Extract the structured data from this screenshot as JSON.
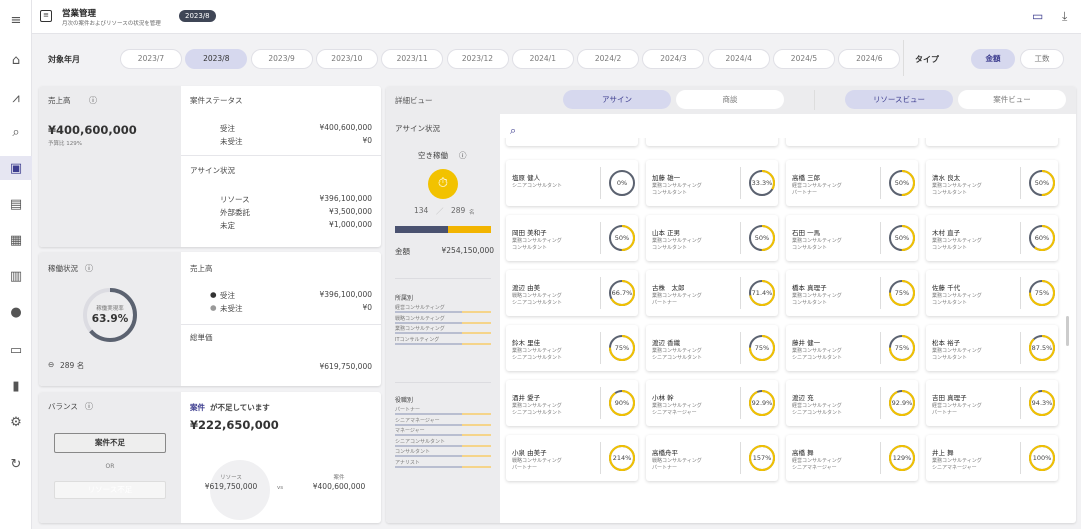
{
  "app": {
    "title": "営業管理",
    "subtitle": "月次の案件およびリソースの状況を管理",
    "month_badge": "2023/8"
  },
  "sidebar": {
    "icons": [
      "menu-icon",
      "home-icon",
      "chart-icon",
      "search-doc-icon",
      "clipboard-icon",
      "list-icon",
      "calendar-icon",
      "building-icon",
      "person-icon",
      "card-icon",
      "bar-chart-icon",
      "gear-icon",
      "refresh-icon"
    ]
  },
  "filter": {
    "month_label": "対象年月",
    "months": [
      "2023/7",
      "2023/8",
      "2023/9",
      "2023/10",
      "2023/11",
      "2023/12",
      "2024/1",
      "2024/2",
      "2024/3",
      "2024/4",
      "2024/5",
      "2024/6"
    ],
    "selected_month": "2023/8",
    "type_label": "タイプ",
    "types": [
      "金額",
      "工数"
    ],
    "selected_type": "金額"
  },
  "sales_card": {
    "title": "売上高",
    "total": "¥400,600,000",
    "budget_ratio": "予算比 129%",
    "status_title": "案件ステータス",
    "status_rows": [
      {
        "label": "受注",
        "value": "¥400,600,000"
      },
      {
        "label": "未受注",
        "value": "¥0"
      }
    ],
    "assign_title": "アサイン状況",
    "assign_rows": [
      {
        "label": "リソース",
        "value": "¥396,100,000"
      },
      {
        "label": "外部委託",
        "value": "¥3,500,000"
      },
      {
        "label": "未定",
        "value": "¥1,000,000"
      }
    ]
  },
  "utilization_card": {
    "title": "稼働状況",
    "gauge_label": "稼働実現率",
    "gauge_value": "63.9%",
    "gauge_fraction": 0.639,
    "people": "289 名",
    "sales_title": "売上高",
    "sales_rows": [
      {
        "label": "受注",
        "value": "¥396,100,000"
      },
      {
        "label": "未受注",
        "value": "¥0"
      }
    ],
    "total_title": "総単価",
    "total_value": "¥619,750,000"
  },
  "balance_card": {
    "title": "バランス",
    "btn_shortage": "案件不足",
    "or": "OR",
    "btn_resource": "リソース不足",
    "message_em": "案件",
    "message": "が不足しています",
    "diff": "¥222,650,000",
    "resource_label": "リソース",
    "resource_value": "¥619,750,000",
    "vs": "vs",
    "project_label": "案件",
    "project_value": "¥400,600,000"
  },
  "detail": {
    "title": "詳細ビュー",
    "tabs_left": [
      "アサイン",
      "商談"
    ],
    "tabs_right": [
      "リソースビュー",
      "案件ビュー"
    ],
    "assign_title": "アサイン状況",
    "idle_label": "空き稼働",
    "idle_count": "134",
    "slash": "／",
    "total_count": "289",
    "unit": "名",
    "amount_label": "金額",
    "amount_value": "¥254,150,000",
    "dept_title": "所属別",
    "depts": [
      "経営コンサルティング",
      "戦略コンサルティング",
      "業務コンサルティング",
      "ITコンサルティング"
    ],
    "role_title": "役職別",
    "roles": [
      "パートナー",
      "シニアマネージャー",
      "マネージャー",
      "シニアコンサルタント",
      "コンサルタント",
      "アナリスト"
    ]
  },
  "people": [
    {
      "name": "塩原 健人",
      "dept": "シニアコンサルタント",
      "role": "",
      "pct": "0%",
      "frac": 0
    },
    {
      "name": "加藤 雄一",
      "dept": "業務コンサルティング",
      "role": "コンサルタント",
      "pct": "33.3%",
      "frac": 0.333
    },
    {
      "name": "高橋 三郎",
      "dept": "経営コンサルティング",
      "role": "パートナー",
      "pct": "50%",
      "frac": 0.5
    },
    {
      "name": "清水 良太",
      "dept": "業務コンサルティング",
      "role": "コンサルタント",
      "pct": "50%",
      "frac": 0.5
    },
    {
      "name": "岡田 美和子",
      "dept": "業務コンサルティング",
      "role": "コンサルタント",
      "pct": "50%",
      "frac": 0.5
    },
    {
      "name": "山本 正男",
      "dept": "業務コンサルティング",
      "role": "コンサルタント",
      "pct": "50%",
      "frac": 0.5
    },
    {
      "name": "石田 一馬",
      "dept": "業務コンサルティング",
      "role": "コンサルタント",
      "pct": "50%",
      "frac": 0.5
    },
    {
      "name": "木村 直子",
      "dept": "業務コンサルティング",
      "role": "コンサルタント",
      "pct": "60%",
      "frac": 0.6
    },
    {
      "name": "渡辺 由美",
      "dept": "戦略コンサルティング",
      "role": "シニアコンサルタント",
      "pct": "66.7%",
      "frac": 0.667
    },
    {
      "name": "古株　太郎",
      "dept": "業務コンサルティング",
      "role": "パートナー",
      "pct": "71.4%",
      "frac": 0.714
    },
    {
      "name": "橋本 真理子",
      "dept": "業務コンサルティング",
      "role": "コンサルタント",
      "pct": "75%",
      "frac": 0.75
    },
    {
      "name": "佐藤 千代",
      "dept": "業務コンサルティング",
      "role": "コンサルタント",
      "pct": "75%",
      "frac": 0.75
    },
    {
      "name": "鈴木 里佳",
      "dept": "業務コンサルティング",
      "role": "シニアコンサルタント",
      "pct": "75%",
      "frac": 0.75
    },
    {
      "name": "渡辺 香織",
      "dept": "業務コンサルティング",
      "role": "シニアコンサルタント",
      "pct": "75%",
      "frac": 0.75
    },
    {
      "name": "藤井 健一",
      "dept": "業務コンサルティング",
      "role": "シニアコンサルタント",
      "pct": "75%",
      "frac": 0.75
    },
    {
      "name": "松本 裕子",
      "dept": "業務コンサルティング",
      "role": "コンサルタント",
      "pct": "87.5%",
      "frac": 0.875
    },
    {
      "name": "酒井 愛子",
      "dept": "業務コンサルティング",
      "role": "シニアコンサルタント",
      "pct": "90%",
      "frac": 0.9
    },
    {
      "name": "小林 幹",
      "dept": "業務コンサルティング",
      "role": "シニアマネージャー",
      "pct": "92.9%",
      "frac": 0.929
    },
    {
      "name": "渡辺 充",
      "dept": "経営コンサルティング",
      "role": "シニアコンサルタント",
      "pct": "92.9%",
      "frac": 0.929
    },
    {
      "name": "吉田 真理子",
      "dept": "経営コンサルティング",
      "role": "パートナー",
      "pct": "94.3%",
      "frac": 0.943
    },
    {
      "name": "小泉 由美子",
      "dept": "戦略コンサルティング",
      "role": "パートナー",
      "pct": "214%",
      "frac": 1
    },
    {
      "name": "高橋舟平",
      "dept": "戦略コンサルティング",
      "role": "パートナー",
      "pct": "157%",
      "frac": 1
    },
    {
      "name": "高橋 舞",
      "dept": "経営コンサルティング",
      "role": "シニアマネージャー",
      "pct": "129%",
      "frac": 1
    },
    {
      "name": "井上 舞",
      "dept": "業務コンサルティング",
      "role": "シニアマネージャー",
      "pct": "100%",
      "frac": 1
    }
  ],
  "colors": {
    "accent": "#3d3d8f",
    "ring_fill": "#f2c200",
    "ring_track": "#5b6270",
    "gauge": "#5b6270",
    "bar_blue": "#4a5270",
    "bar_yellow": "#f2b400"
  }
}
